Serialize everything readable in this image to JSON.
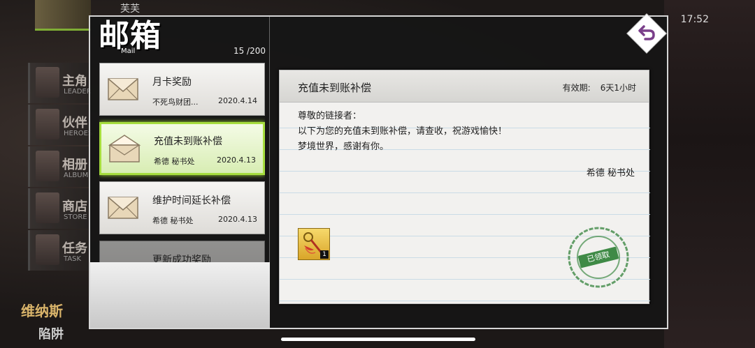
{
  "background": {
    "player_name": "芙芙",
    "status_time": "17:52",
    "side_menu": [
      {
        "title": "主角",
        "subtitle": "LEADER"
      },
      {
        "title": "伙伴",
        "subtitle": "HEROES"
      },
      {
        "title": "相册",
        "subtitle": "ALBUM"
      },
      {
        "title": "商店",
        "subtitle": "STORE"
      },
      {
        "title": "任务",
        "subtitle": "TASK"
      }
    ],
    "bottom_title": "维纳斯",
    "bottom_subtitle": "陷阱"
  },
  "mailbox": {
    "title": "邮箱",
    "subtitle": "Mail",
    "count": "15 /200",
    "items": [
      {
        "subject": "月卡奖励",
        "sender": "不死鸟财团...",
        "date": "2020.4.14"
      },
      {
        "subject": "充值未到账补偿",
        "sender": "希德 秘书处",
        "date": "2020.4.13"
      },
      {
        "subject": "维护时间延长补偿",
        "sender": "希德 秘书处",
        "date": "2020.4.13"
      },
      {
        "subject": "更新成功奖励",
        "sender": "",
        "date": ""
      }
    ]
  },
  "letter": {
    "title": "充值未到账补偿",
    "expiry_label": "有效期:",
    "expiry_value": "6天1小时",
    "lines": [
      "尊敬的链接者：",
      "以下为您的充值未到账补偿，请查收，祝游戏愉快！",
      "梦境世界，感谢有你。"
    ],
    "signature": "希德 秘书处",
    "attachment": {
      "icon": "key-charm-icon",
      "count": "1"
    },
    "stamp": {
      "label": "已领取",
      "ring_text": "NIGHTMARE"
    }
  },
  "colors": {
    "active_border": "#a6dd3e",
    "stamp_green": "#3f8a46",
    "back_icon": "#7a3f8a"
  }
}
